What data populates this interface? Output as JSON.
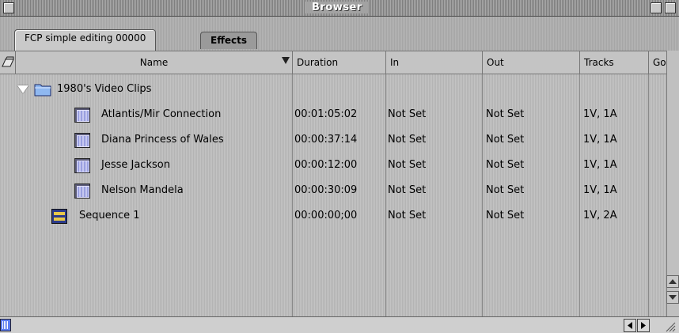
{
  "window": {
    "title": "Browser"
  },
  "tabs": [
    {
      "label": "FCP simple editing 00000",
      "active": true
    },
    {
      "label": "Effects",
      "active": false
    }
  ],
  "columns": {
    "name": "Name",
    "duration": "Duration",
    "in": "In",
    "out": "Out",
    "tracks": "Tracks",
    "good": "Go"
  },
  "folder": {
    "name": "1980's Video Clips",
    "expanded": true,
    "icon": "folder-icon"
  },
  "clips": [
    {
      "name": "Atlantis/Mir Connection",
      "duration": "00:01:05:02",
      "in": "Not Set",
      "out": "Not Set",
      "tracks": "1V, 1A",
      "icon": "clip-icon"
    },
    {
      "name": "Diana Princess of Wales",
      "duration": "00:00:37:14",
      "in": "Not Set",
      "out": "Not Set",
      "tracks": "1V, 1A",
      "icon": "clip-icon"
    },
    {
      "name": "Jesse Jackson",
      "duration": "00:00:12:00",
      "in": "Not Set",
      "out": "Not Set",
      "tracks": "1V, 1A",
      "icon": "clip-icon"
    },
    {
      "name": "Nelson Mandela",
      "duration": "00:00:30:09",
      "in": "Not Set",
      "out": "Not Set",
      "tracks": "1V, 1A",
      "icon": "clip-icon"
    }
  ],
  "sequence": {
    "name": "Sequence 1",
    "duration": "00:00:00;00",
    "in": "Not Set",
    "out": "Not Set",
    "tracks": "1V, 2A",
    "icon": "sequence-icon"
  }
}
